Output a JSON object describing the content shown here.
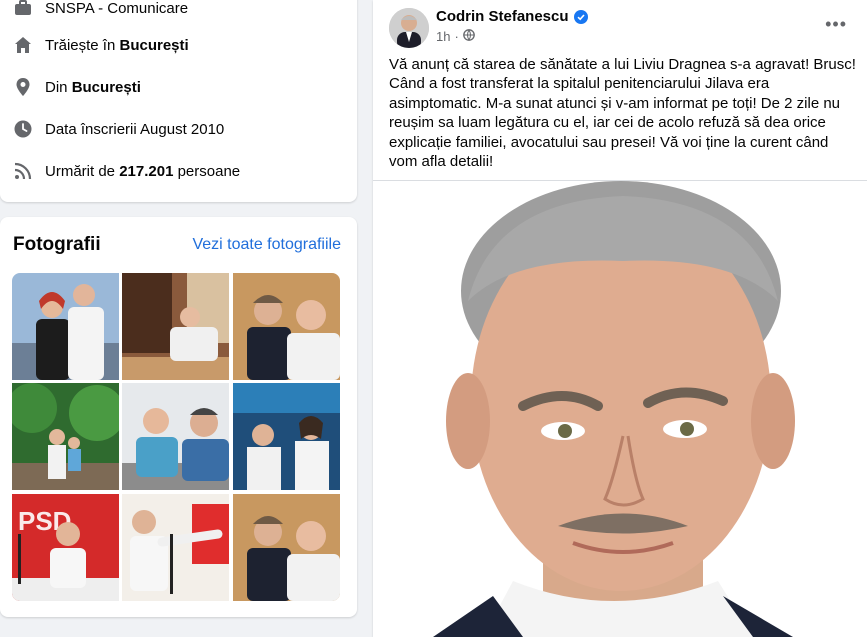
{
  "intro": {
    "items": [
      {
        "icon": "work-icon",
        "text_prefix": "",
        "text_bold": "SNSPA - Comunicare",
        "text_suffix": ""
      },
      {
        "icon": "home-icon",
        "text_prefix": "Trăiește în ",
        "text_bold": "București",
        "text_suffix": ""
      },
      {
        "icon": "location-pin-icon",
        "text_prefix": "Din ",
        "text_bold": "București",
        "text_suffix": ""
      },
      {
        "icon": "clock-icon",
        "text_prefix": "Data înscrierii August 2010",
        "text_bold": "",
        "text_suffix": ""
      },
      {
        "icon": "rss-icon",
        "text_prefix": "Urmărit de ",
        "text_bold": "217.201",
        "text_suffix": " persoane"
      }
    ]
  },
  "photos": {
    "title": "Fotografii",
    "see_all": "Vezi toate fotografiile",
    "items": [
      "photo-1",
      "photo-2",
      "photo-3",
      "photo-4",
      "photo-5",
      "photo-6",
      "photo-7",
      "photo-8",
      "photo-9"
    ]
  },
  "post": {
    "author": "Codrin Stefanescu",
    "time": "1h",
    "audience_icon": "globe-icon",
    "more_label": "•••",
    "text": "Vă anunț că starea de sănătate a lui Liviu Dragnea s-a agravat! Brusc! Când a fost transferat la spitalul penitenciarului Jilava era asimptomatic. M-a sunat atunci și v-am informat pe toți! De 2 zile nu reușim sa luam legătura cu el, iar cei de acolo refuză să dea orice explicație familiei, avocatului sau presei! Vă voi ține la curent când vom afla detalii!"
  },
  "colors": {
    "link": "#216fdb",
    "verified": "#1877f2",
    "bg": "#f0f2f5"
  }
}
